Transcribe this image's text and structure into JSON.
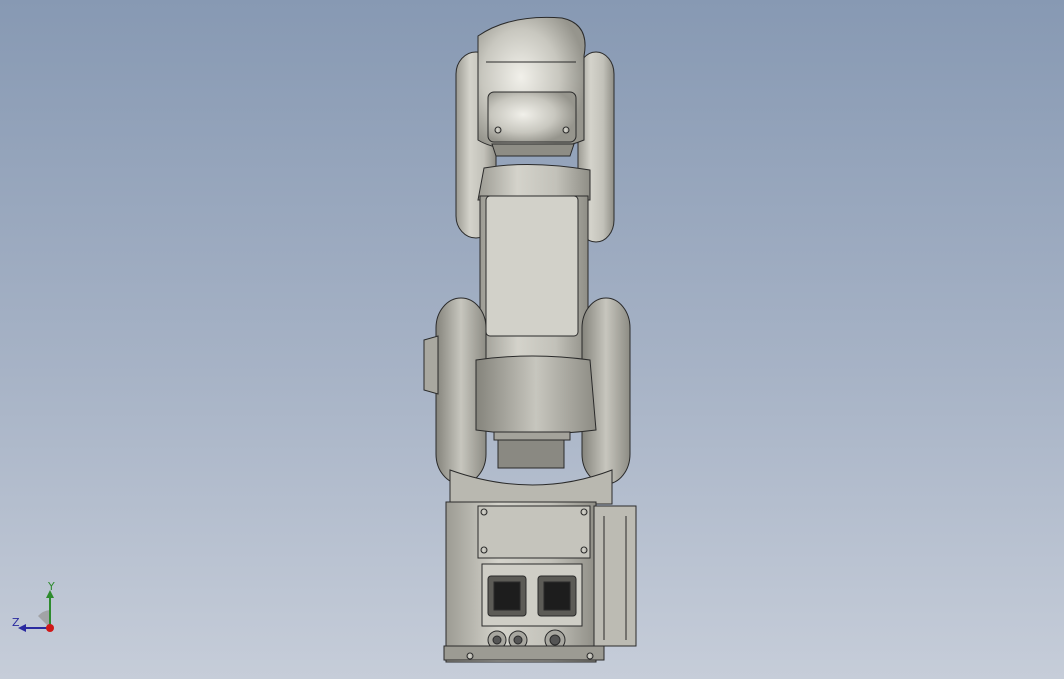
{
  "viewport": {
    "background_top": "#8799b3",
    "background_bottom": "#c6cdd9",
    "model_color": "#c8c7bf",
    "edge_color": "#2a2a2a"
  },
  "axis_triad": {
    "y_label": "Y",
    "z_label": "Z",
    "y_color": "#2e8b2e",
    "z_color": "#2a2aa0",
    "x_color": "#d01818"
  }
}
